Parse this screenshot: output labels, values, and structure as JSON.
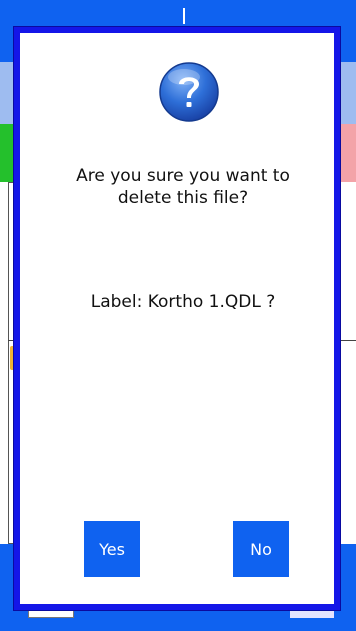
{
  "dialog": {
    "message": "Are you sure you want to\ndelete this file?",
    "label_line": "Label: Kortho 1.QDL ?",
    "yes_label": "Yes",
    "no_label": "No",
    "icon": "question-icon"
  },
  "colors": {
    "dialog_border": "#1416e8",
    "button_bg": "#0f62f0",
    "button_text": "#ffffff",
    "app_blue": "#0f62f0",
    "app_light_blue": "#9ebcf0",
    "app_green": "#24c02c",
    "app_pink": "#f3a3a8"
  }
}
